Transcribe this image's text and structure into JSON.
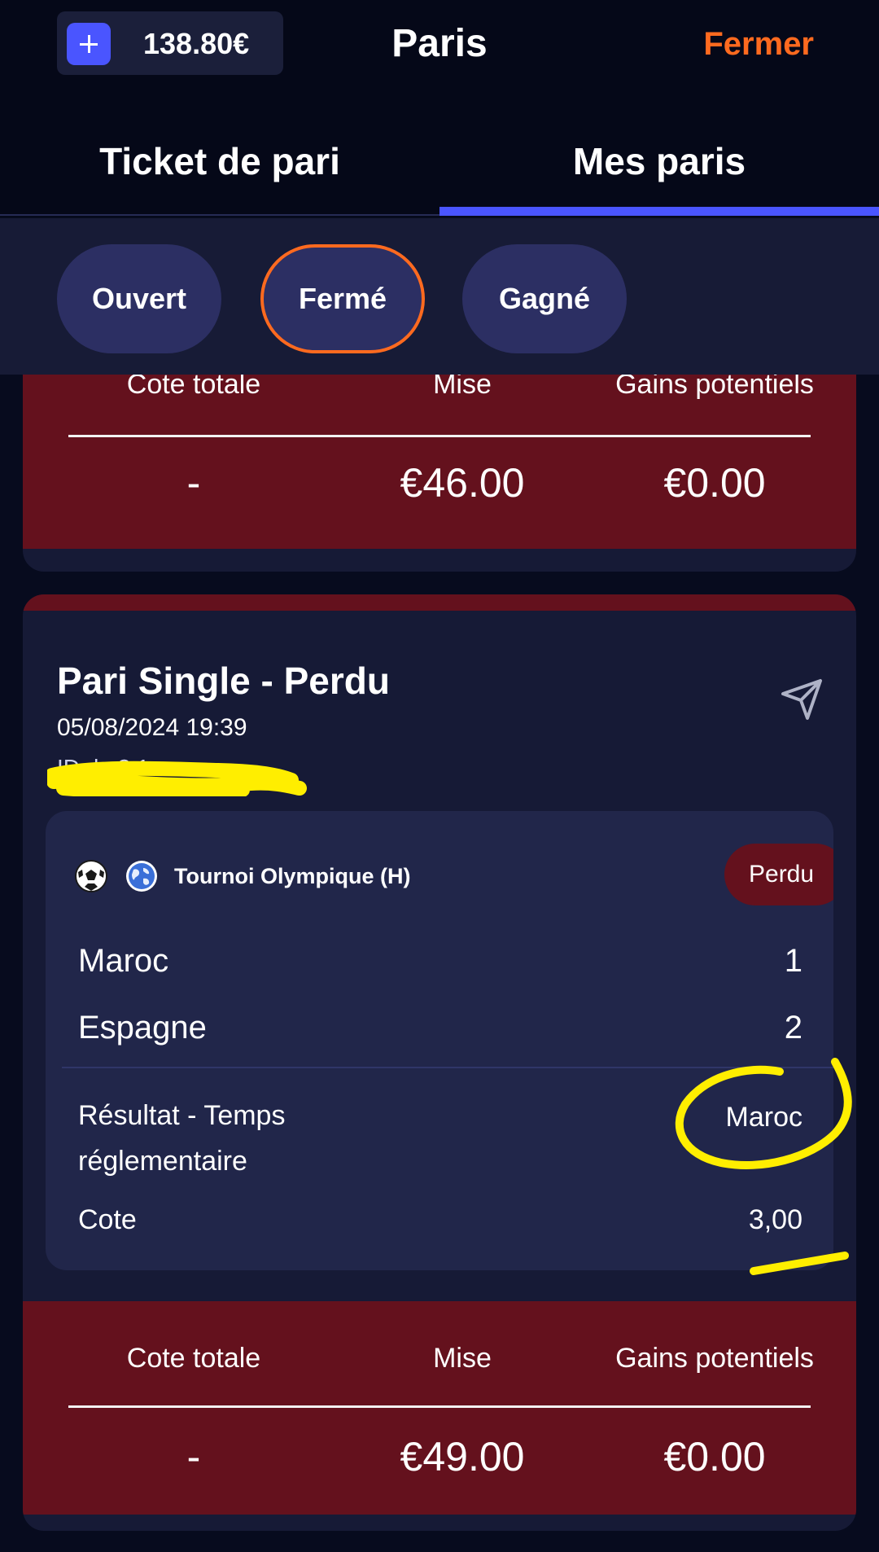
{
  "header": {
    "balance": "138.80€",
    "title": "Paris",
    "close_label": "Fermer"
  },
  "tabs": [
    {
      "label": "Ticket de pari",
      "active": false
    },
    {
      "label": "Mes paris",
      "active": true
    }
  ],
  "filters": [
    {
      "label": "Ouvert",
      "selected": false
    },
    {
      "label": "Fermé",
      "selected": true
    },
    {
      "label": "Gagné",
      "selected": false
    }
  ],
  "previous_bet": {
    "headers": [
      "Cote totale",
      "Mise",
      "Gains potentiels"
    ],
    "values": [
      "-",
      "€46.00",
      "€0.00"
    ]
  },
  "bet": {
    "title": "Pari Single - Perdu",
    "date": "05/08/2024 19:39",
    "id_text": "ID d...3.1",
    "event": {
      "competition": "Tournoi Olympique (H)",
      "status": "Perdu",
      "teams": [
        {
          "name": "Maroc",
          "score": "1"
        },
        {
          "name": "Espagne",
          "score": "2"
        }
      ],
      "market": "Résultat - Temps réglementaire",
      "selection": "Maroc",
      "odds_label": "Cote",
      "odds": "3,00"
    },
    "summary": {
      "headers": [
        "Cote totale",
        "Mise",
        "Gains potentiels"
      ],
      "values": [
        "-",
        "€49.00",
        "€0.00"
      ]
    }
  },
  "colors": {
    "background": "#070b1e",
    "accent_blue": "#4a55ff",
    "accent_orange": "#ff6a1f",
    "loss_red": "#64111d",
    "card": "#161a36",
    "highlight_yellow": "#ffee00"
  },
  "icons": [
    "plus-icon",
    "share-icon",
    "football-icon",
    "globe-icon"
  ]
}
